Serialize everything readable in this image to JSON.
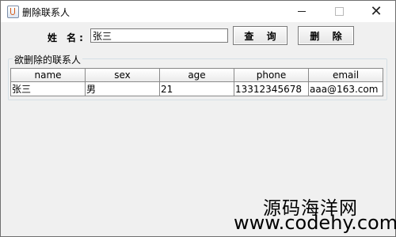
{
  "window": {
    "title": "删除联系人",
    "close_symbol": "✕"
  },
  "form": {
    "name_label": "姓 名:",
    "name_value": "张三",
    "search_label": "查 询",
    "delete_label": "删 除"
  },
  "table": {
    "group_title": "欲删除的联系人",
    "columns": [
      "name",
      "sex",
      "age",
      "phone",
      "email"
    ],
    "rows": [
      [
        "张三",
        "男",
        "21",
        "13312345678",
        "aaa@163.com"
      ]
    ]
  },
  "watermark": {
    "line1": "源码海洋网",
    "line2": "www.codehy.com"
  }
}
